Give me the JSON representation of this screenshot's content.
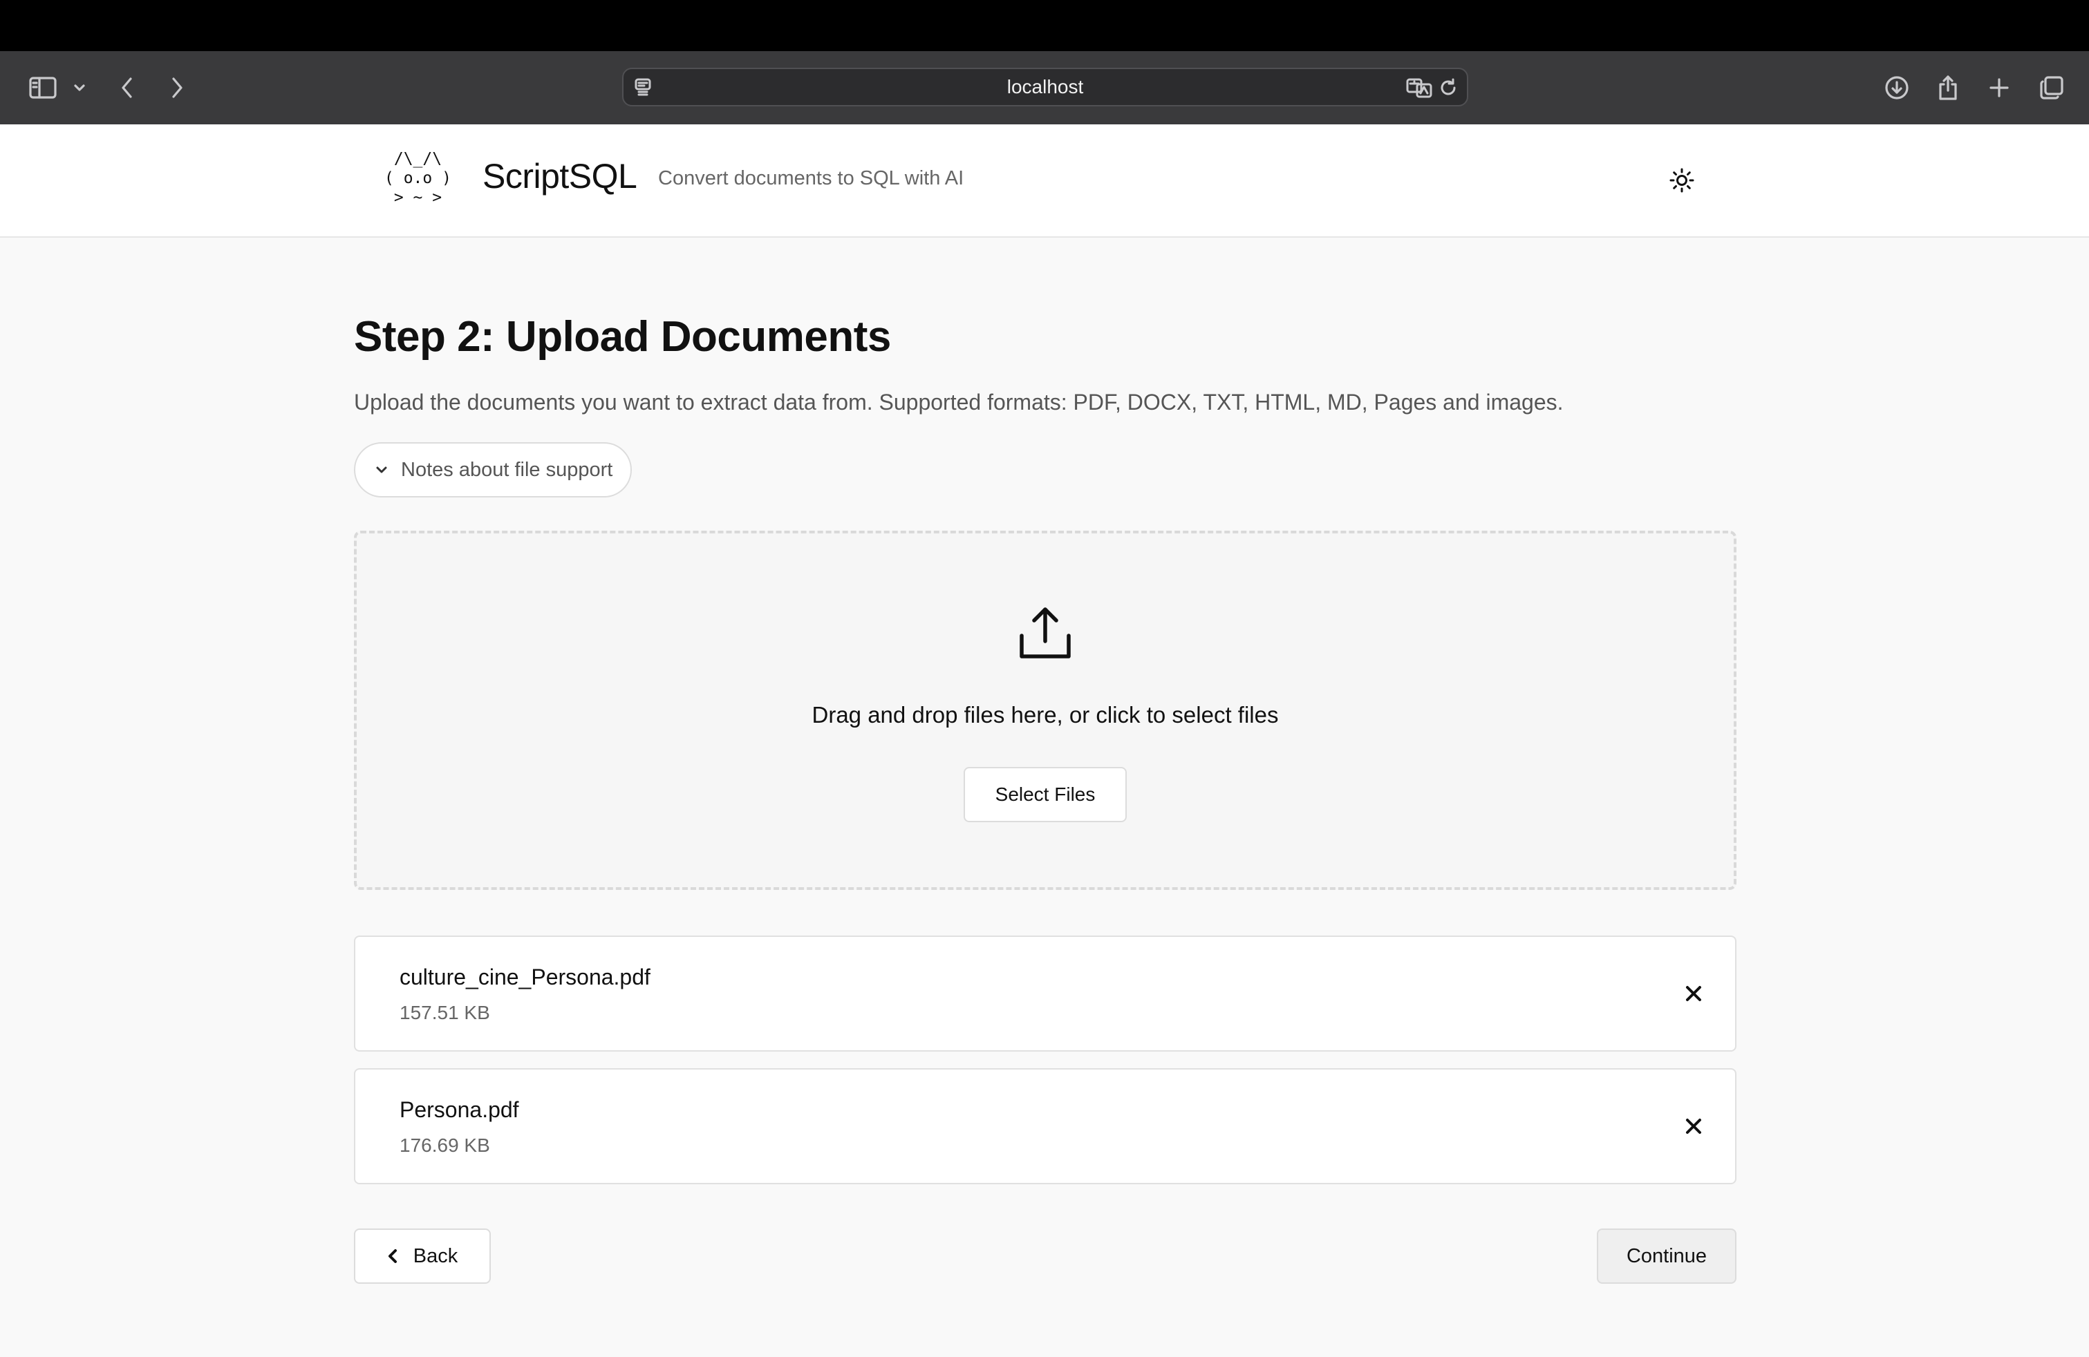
{
  "browser": {
    "address": "localhost",
    "icons": {
      "sidebar": "sidebar-icon",
      "sidebar_menu": "chevron-down-icon",
      "back": "chevron-left-icon",
      "forward": "chevron-right-icon",
      "page_menu": "page-menu-icon",
      "translate": "translate-icon",
      "reload": "reload-icon",
      "downloads": "download-icon",
      "share": "share-icon",
      "new_tab": "plus-icon",
      "tabs_overview": "tabs-icon"
    }
  },
  "header": {
    "logo_lines": [
      " /\\_/\\",
      "( o.o )",
      " > ~ >"
    ],
    "app_name": "ScriptSQL",
    "tagline": "Convert documents to SQL with AI",
    "theme_icon": "sun-icon"
  },
  "main": {
    "title": "Step 2: Upload Documents",
    "description": "Upload the documents you want to extract data from. Supported formats: PDF, DOCX, TXT, HTML, MD, Pages and images.",
    "notes_label": "Notes about file support",
    "dropzone": {
      "icon": "upload-icon",
      "text": "Drag and drop files here, or click to select files",
      "button_label": "Select Files"
    },
    "files": [
      {
        "name": "culture_cine_Persona.pdf",
        "size": "157.51 KB"
      },
      {
        "name": "Persona.pdf",
        "size": "176.69 KB"
      }
    ],
    "back_label": "Back",
    "continue_label": "Continue"
  },
  "colors": {
    "page_bg": "#f9f9f9",
    "header_bg": "#ffffff",
    "toolbar_bg": "#3a3a3c",
    "text_primary": "#111111",
    "text_muted": "#666666"
  }
}
